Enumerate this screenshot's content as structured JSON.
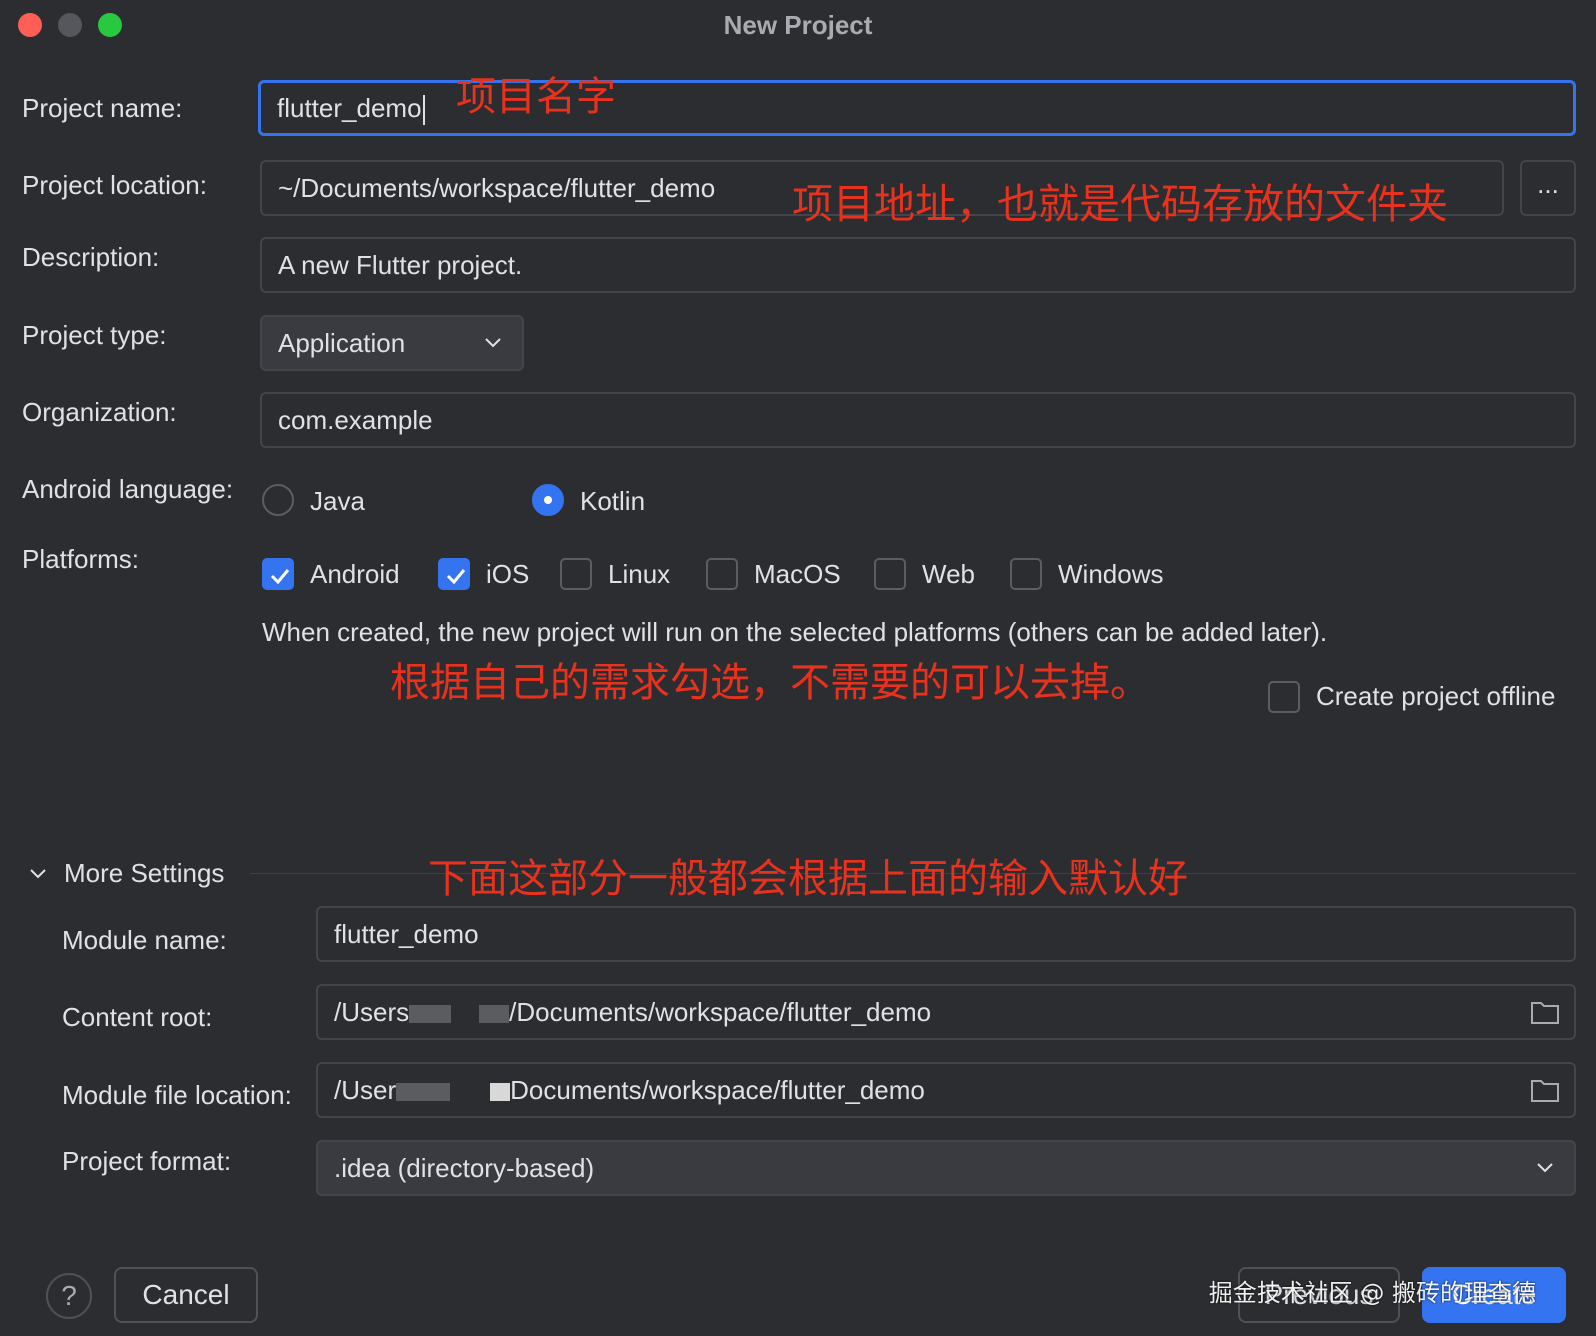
{
  "window": {
    "title": "New Project"
  },
  "form": {
    "project_name_label": "Project name:",
    "project_name_value": "flutter_demo",
    "project_location_label": "Project location:",
    "project_location_value": "~/Documents/workspace/flutter_demo",
    "browse_label": "...",
    "description_label": "Description:",
    "description_value": "A new Flutter project.",
    "project_type_label": "Project type:",
    "project_type_value": "Application",
    "organization_label": "Organization:",
    "organization_value": "com.example",
    "android_language_label": "Android language:",
    "language_options": [
      {
        "label": "Java",
        "selected": false
      },
      {
        "label": "Kotlin",
        "selected": true
      }
    ],
    "platforms_label": "Platforms:",
    "platforms": [
      {
        "label": "Android",
        "checked": true
      },
      {
        "label": "iOS",
        "checked": true
      },
      {
        "label": "Linux",
        "checked": false
      },
      {
        "label": "MacOS",
        "checked": false
      },
      {
        "label": "Web",
        "checked": false
      },
      {
        "label": "Windows",
        "checked": false
      }
    ],
    "platforms_hint": "When created, the new project will run on the selected platforms (others can be added later).",
    "offline_label": "Create project offline",
    "offline_checked": false
  },
  "more_settings": {
    "title": "More Settings",
    "module_name_label": "Module name:",
    "module_name_value": "flutter_demo",
    "content_root_label": "Content root:",
    "content_root_prefix": "/Users",
    "content_root_suffix": "/Documents/workspace/flutter_demo",
    "module_file_label": "Module file location:",
    "module_file_prefix": "/User",
    "module_file_suffix": "Documents/workspace/flutter_demo",
    "project_format_label": "Project format:",
    "project_format_value": ".idea (directory-based)"
  },
  "annotations": {
    "name_note": "项目名字",
    "location_note": "项目地址，也就是代码存放的文件夹",
    "platforms_note": "根据自己的需求勾选，不需要的可以去掉。",
    "more_note": "下面这部分一般都会根据上面的输入默认好"
  },
  "footer": {
    "help_label": "?",
    "cancel_label": "Cancel",
    "previous_label": "Previous",
    "create_label": "Create",
    "watermark": "掘金技术社区 @ 搬砖的理查德"
  },
  "colors": {
    "accent": "#3574f0",
    "annotation": "#e8321e",
    "background": "#2b2d30"
  }
}
